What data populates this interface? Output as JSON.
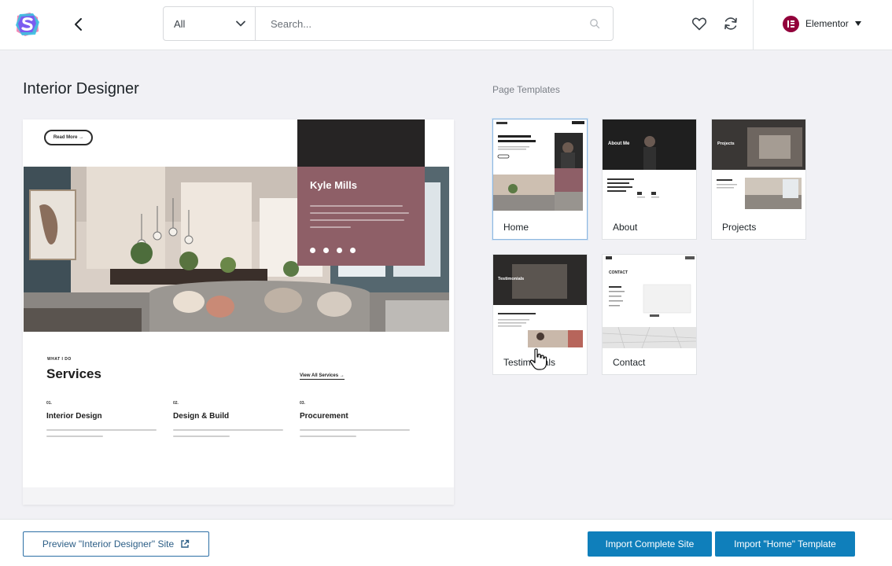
{
  "header": {
    "filter_value": "All",
    "search_placeholder": "Search...",
    "builder_label": "Elementor"
  },
  "main": {
    "title": "Interior Designer",
    "section_label": "Page Templates"
  },
  "preview": {
    "read_more": "Read More →",
    "profile_name": "Kyle Mills",
    "eyebrow": "WHAT I DO",
    "heading": "Services",
    "view_all": "View All Services →",
    "services": [
      {
        "num": "01.",
        "title": "Interior Design"
      },
      {
        "num": "02.",
        "title": "Design & Build"
      },
      {
        "num": "03.",
        "title": "Procurement"
      }
    ]
  },
  "templates": [
    {
      "label": "Home",
      "selected": true
    },
    {
      "label": "About",
      "thumb_text": "About Me"
    },
    {
      "label": "Projects",
      "thumb_text": "Projects"
    },
    {
      "label": "Testimonials",
      "thumb_text": "Testimonials"
    },
    {
      "label": "Contact",
      "thumb_text": "CONTACT"
    }
  ],
  "footer": {
    "preview_button": "Preview \"Interior Designer\" Site",
    "import_site_button": "Import Complete Site",
    "import_template_button": "Import \"Home\" Template"
  },
  "colors": {
    "accent": "#0f7fbb",
    "elementor": "#92003b",
    "profile_card": "#8e5f67"
  }
}
